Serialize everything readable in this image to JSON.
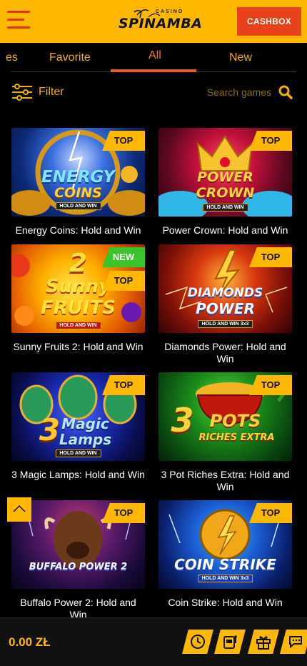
{
  "header": {
    "logo_small": "CASINO",
    "logo_word": "SPINAMBA",
    "cashbox_label": "CASHBOX"
  },
  "tabs": [
    {
      "label": "es"
    },
    {
      "label": "Favorite"
    },
    {
      "label": "All",
      "active": true
    },
    {
      "label": "New"
    }
  ],
  "filter": {
    "label": "Filter"
  },
  "search": {
    "placeholder": "Search games"
  },
  "games": [
    {
      "title": "Energy Coins: Hold and Win",
      "badges": [
        "TOP"
      ],
      "art": {
        "line1": "ENERGY",
        "line2": "COINS",
        "sub": "HOLD AND WIN"
      }
    },
    {
      "title": "Power Crown: Hold and Win",
      "badges": [
        "TOP"
      ],
      "art": {
        "line1": "POWER",
        "line2": "CROWN",
        "sub": "HOLD AND WIN"
      }
    },
    {
      "title": "Sunny Fruits 2: Hold and Win",
      "badges": [
        "NEW",
        "TOP"
      ],
      "art": {
        "line0": "2",
        "line1": "Sunny",
        "line2": "FRUITS",
        "sub": "HOLD AND WIN"
      }
    },
    {
      "title": "Diamonds Power: Hold and Win",
      "badges": [
        "TOP"
      ],
      "art": {
        "line1": "DIAMONDS",
        "line2": "POWER",
        "sub": "HOLD AND WIN 3x3"
      }
    },
    {
      "title": "3 Magic Lamps: Hold and Win",
      "badges": [
        "TOP"
      ],
      "art": {
        "line0": "3",
        "line1": "Magic",
        "line2": "Lamps",
        "sub": "HOLD AND WIN"
      }
    },
    {
      "title": "3 Pot Riches Extra: Hold and Win",
      "badges": [
        "TOP"
      ],
      "art": {
        "line0": "3",
        "line1": "POTS",
        "line2": "RICHES EXTRA",
        "sub": ""
      }
    },
    {
      "title": "Buffalo Power 2: Hold and Win",
      "badges": [
        "TOP"
      ],
      "art": {
        "line1": "BUFFALO POWER 2",
        "line2": "",
        "sub": "HOLD AND WIN"
      }
    },
    {
      "title": "Coin Strike: Hold and Win",
      "badges": [
        "TOP"
      ],
      "art": {
        "line1": "COIN STRIKE",
        "line2": "",
        "sub": "HOLD AND WIN 3x3"
      }
    }
  ],
  "footer": {
    "balance": "0.00 ZŁ",
    "buttons": [
      {
        "icon": "clock-icon"
      },
      {
        "icon": "slot-machine-icon"
      },
      {
        "icon": "gift-icon"
      },
      {
        "icon": "chat-icon"
      }
    ]
  },
  "colors": {
    "accent": "#ffb800",
    "cashbox": "#e8421c",
    "tab_active": "#f07a1e",
    "new_badge": "#39c42a",
    "background": "#000000"
  }
}
